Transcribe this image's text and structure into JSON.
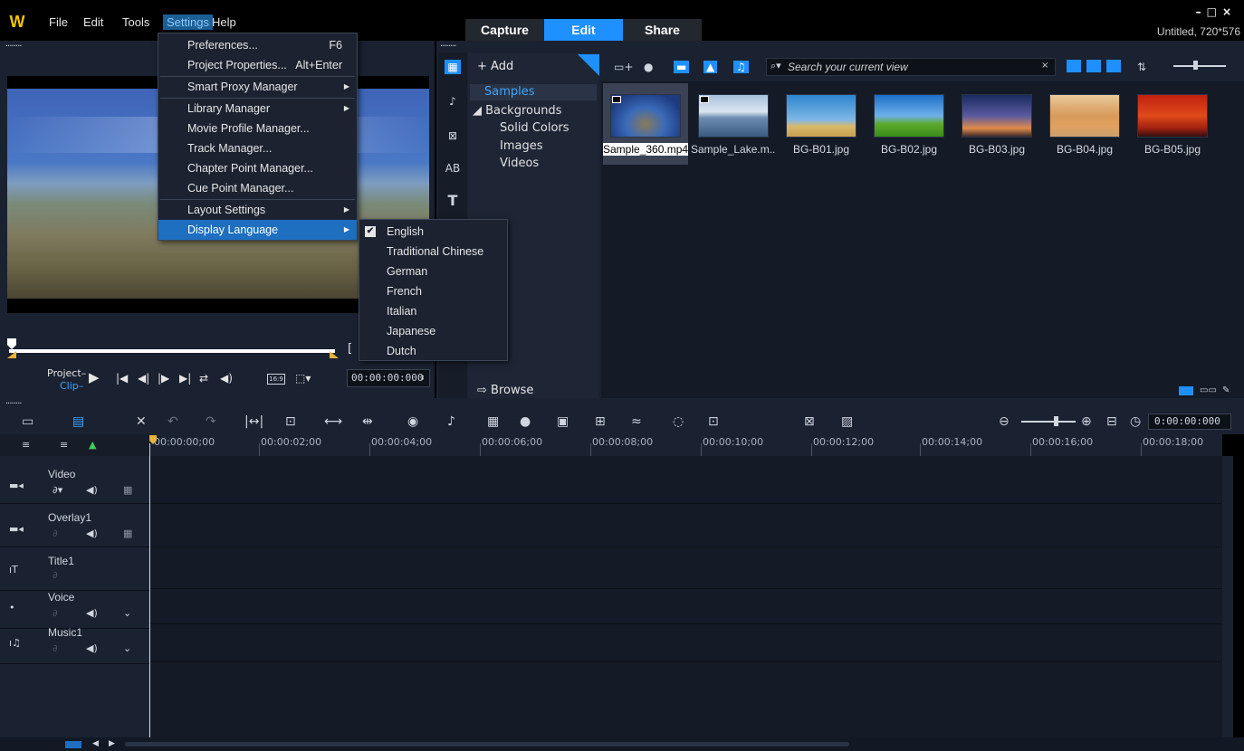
{
  "app": {
    "document_title": "Untitled, 720*576",
    "window_controls": [
      "–",
      "□",
      "×"
    ]
  },
  "menubar": {
    "items": [
      "File",
      "Edit",
      "Tools",
      "Settings",
      "Help"
    ]
  },
  "tabs": [
    "Capture",
    "Edit",
    "Share"
  ],
  "settings_menu": {
    "items": [
      {
        "label": "Preferences...",
        "shortcut": "F6"
      },
      {
        "label": "Project Properties...",
        "shortcut": "Alt+Enter"
      },
      {
        "label": "Smart Proxy Manager",
        "submenu": true
      },
      {
        "label": "Library Manager",
        "submenu": true
      },
      {
        "label": "Movie Profile Manager..."
      },
      {
        "label": "Track Manager..."
      },
      {
        "label": "Chapter Point Manager..."
      },
      {
        "label": "Cue Point Manager..."
      },
      {
        "label": "Layout Settings",
        "submenu": true
      },
      {
        "label": "Display Language",
        "submenu": true,
        "highlighted": true
      }
    ]
  },
  "language_menu": {
    "items": [
      "English",
      "Traditional Chinese",
      "German",
      "French",
      "Italian",
      "Japanese",
      "Dutch"
    ],
    "checked": "English"
  },
  "player": {
    "mode_project": "Project–",
    "mode_clip": "Clip–",
    "aspect": "16:9",
    "timecode": "00:00:00:000"
  },
  "library": {
    "add_label": "Add",
    "browse_label": "Browse",
    "search_placeholder": "Search your current view",
    "tree": {
      "selected": "Samples",
      "group": "◢ Backgrounds",
      "children": [
        "Solid Colors",
        "Images",
        "Videos"
      ]
    },
    "thumbnails": [
      {
        "name": "Sample_360.mp4",
        "selected": true,
        "video": true
      },
      {
        "name": "Sample_Lake.m...",
        "video": true
      },
      {
        "name": "BG-B01.jpg"
      },
      {
        "name": "BG-B02.jpg"
      },
      {
        "name": "BG-B03.jpg"
      },
      {
        "name": "BG-B04.jpg"
      },
      {
        "name": "BG-B05.jpg"
      }
    ]
  },
  "timeline": {
    "zoom_timecode": "0:00:00:000",
    "ruler": [
      "00:00:00;00",
      "00:00:02;00",
      "00:00:04;00",
      "00:00:06;00",
      "00:00:08;00",
      "00:00:10;00",
      "00:00:12;00",
      "00:00:14;00",
      "00:00:16;00",
      "00:00:18;00"
    ],
    "tracks": [
      "Video",
      "Overlay1",
      "Title1",
      "Voice",
      "Music1"
    ]
  },
  "colors": {
    "accent": "#1e90ff",
    "menu_highlight": "#1e6fc0",
    "panel": "#1a2130"
  }
}
